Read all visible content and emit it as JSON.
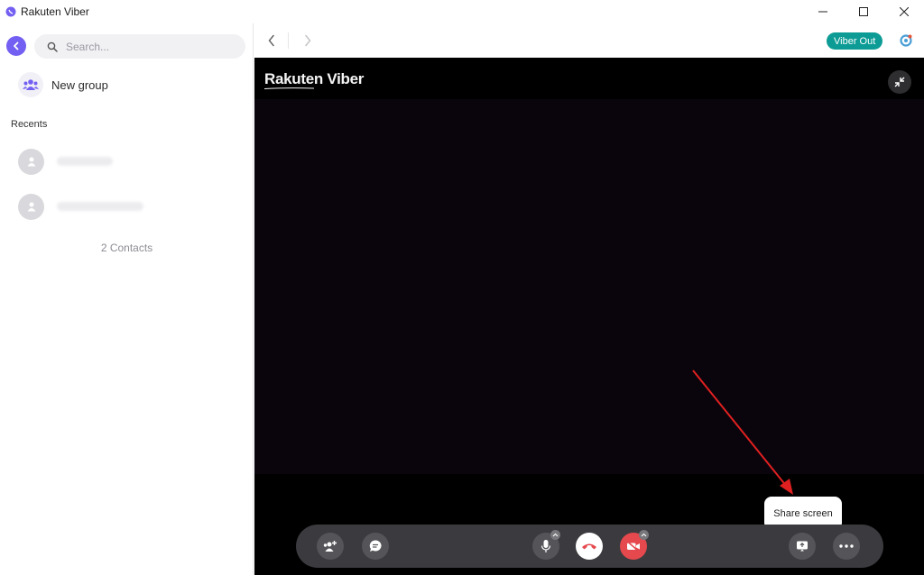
{
  "window": {
    "title": "Rakuten Viber",
    "controls": {
      "minimize": "minimize-icon",
      "maximize": "maximize-icon",
      "close": "close-icon"
    }
  },
  "sidebar": {
    "search": {
      "placeholder": "Search..."
    },
    "new_group_label": "New group",
    "recents_label": "Recents",
    "contacts_count": "2 Contacts"
  },
  "topbar": {
    "viber_out_label": "Viber Out"
  },
  "call": {
    "brand": "Rakuten Viber",
    "tooltip": "Share screen"
  },
  "colors": {
    "accent": "#7360f2",
    "viber_out": "#0d9c95",
    "end_call": "#e5484d",
    "annotation_arrow": "#e02020"
  }
}
